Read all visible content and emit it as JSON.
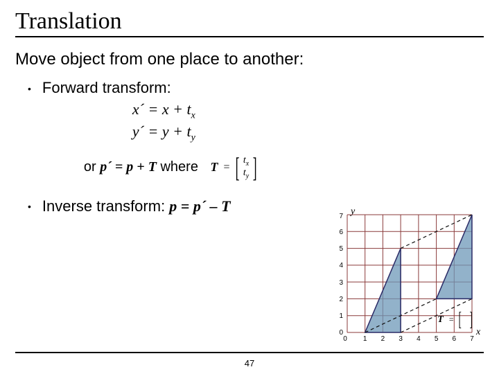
{
  "title": "Translation",
  "subtitle": "Move object from one place to another:",
  "forward": {
    "heading": "Forward transform:",
    "eq1_lhs": "x´",
    "eq1_rhs": " = x + t",
    "eq1_sub": "x",
    "eq2_lhs": "y´",
    "eq2_rhs": " = y + t",
    "eq2_sub": "y"
  },
  "orline": {
    "or": "or ",
    "eq": "p´ = p + T",
    "where": " where"
  },
  "matrixT": {
    "label": "T",
    "eq": "=",
    "r1": "t",
    "r1s": "x",
    "r2": "t",
    "r2s": "y"
  },
  "inverse": {
    "heading": "Inverse transform: ",
    "eq": "p = p´ – T"
  },
  "page_number": "47",
  "chart_data": {
    "type": "line",
    "xlim": [
      0,
      7
    ],
    "ylim": [
      0,
      7
    ],
    "xlabel": "x",
    "ylabel": "y",
    "annotation": "T =",
    "series": [
      {
        "name": "original-triangle",
        "points": [
          [
            1,
            0
          ],
          [
            3,
            0
          ],
          [
            3,
            5
          ],
          [
            1,
            0
          ]
        ]
      },
      {
        "name": "translated-triangle",
        "points": [
          [
            5,
            2
          ],
          [
            7,
            2
          ],
          [
            7,
            7
          ],
          [
            5,
            2
          ]
        ]
      },
      {
        "name": "map-v1",
        "points": [
          [
            1,
            0
          ],
          [
            5,
            2
          ]
        ]
      },
      {
        "name": "map-v2",
        "points": [
          [
            3,
            0
          ],
          [
            7,
            2
          ]
        ]
      },
      {
        "name": "map-v3",
        "points": [
          [
            3,
            5
          ],
          [
            7,
            7
          ]
        ]
      }
    ],
    "translation_vector": [
      4,
      2
    ]
  }
}
